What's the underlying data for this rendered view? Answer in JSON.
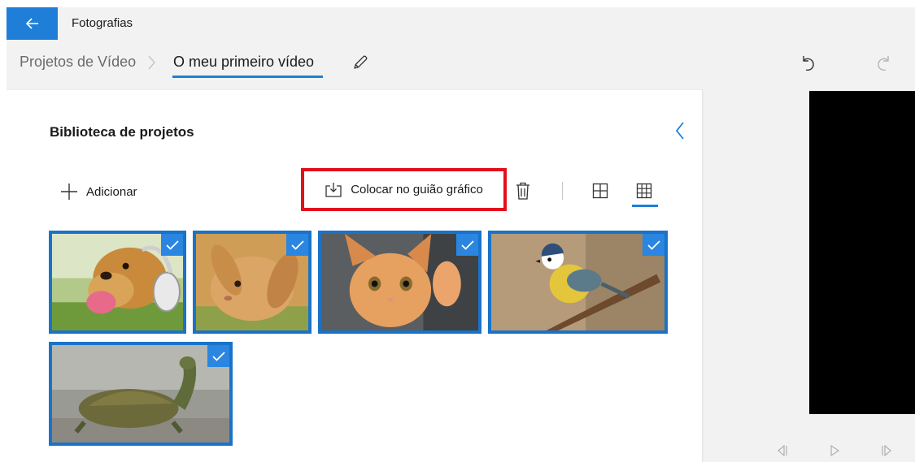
{
  "app": {
    "title": "Fotografias"
  },
  "breadcrumb": {
    "root": "Projetos de Vídeo",
    "current": "O meu primeiro vídeo"
  },
  "library": {
    "title": "Biblioteca de projetos",
    "add_label": "Adicionar",
    "place_label": "Colocar no guião gráfico",
    "items": [
      {
        "subject": "dog",
        "selected": true
      },
      {
        "subject": "rabbit",
        "selected": true
      },
      {
        "subject": "kitten",
        "selected": true
      },
      {
        "subject": "bird",
        "selected": true
      },
      {
        "subject": "turtle",
        "selected": true
      }
    ]
  },
  "icons": {
    "back": "arrow-left-icon",
    "edit": "pencil-icon",
    "undo": "undo-icon",
    "redo": "redo-icon",
    "collapse": "chevron-left-icon",
    "add": "plus-icon",
    "place": "place-in-storyboard-icon",
    "delete": "trash-icon",
    "view_large": "large-grid-icon",
    "view_small": "small-grid-icon",
    "check": "checkmark-icon",
    "prev_frame": "previous-frame-icon",
    "play": "play-icon",
    "next_frame": "next-frame-icon"
  },
  "colors": {
    "accent": "#1f7fd8",
    "highlight": "#e3101b",
    "selection_border": "#1a73c8",
    "preview_background": "#000000"
  }
}
